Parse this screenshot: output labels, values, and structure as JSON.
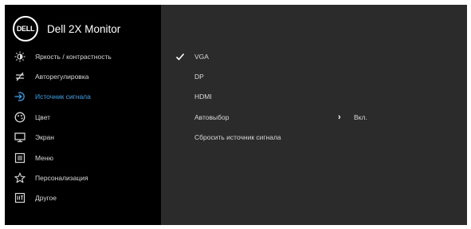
{
  "header": {
    "logo_text": "DELL",
    "title": "Dell 2X Monitor"
  },
  "menu": {
    "items": [
      {
        "label": "Яркость / контрастность",
        "icon": "brightness-icon"
      },
      {
        "label": "Авторегулировка",
        "icon": "auto-adjust-icon"
      },
      {
        "label": "Источник сигнала",
        "icon": "input-source-icon",
        "active": true
      },
      {
        "label": "Цвет",
        "icon": "color-icon"
      },
      {
        "label": "Экран",
        "icon": "display-icon"
      },
      {
        "label": "Меню",
        "icon": "menu-icon"
      },
      {
        "label": "Персонализация",
        "icon": "star-icon"
      },
      {
        "label": "Другое",
        "icon": "other-icon"
      }
    ]
  },
  "submenu": {
    "items": [
      {
        "label": "VGA",
        "checked": true
      },
      {
        "label": "DP"
      },
      {
        "label": "HDMI"
      },
      {
        "label": "Автовыбор",
        "value": "Вкл."
      },
      {
        "label": "Сбросить  источник сигнала"
      }
    ]
  },
  "colors": {
    "accent": "#2aa4ee",
    "left_panel": "#000000",
    "right_panel": "#2b2b2b"
  }
}
